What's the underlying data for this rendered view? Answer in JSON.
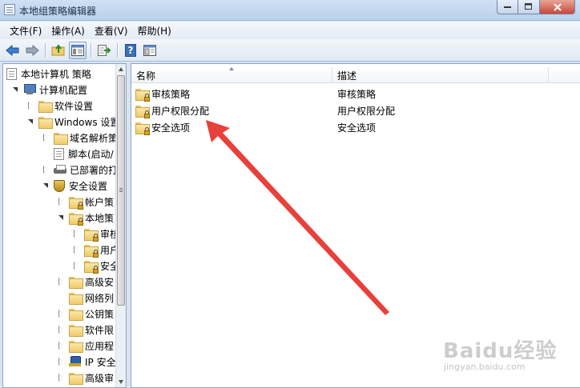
{
  "window": {
    "title": "本地组策略编辑器",
    "controls": [
      "minimize",
      "maximize",
      "close"
    ]
  },
  "menu": [
    "文件(F)",
    "操作(A)",
    "查看(V)",
    "帮助(H)"
  ],
  "toolbar": {
    "icons": [
      "back-icon",
      "forward-icon",
      "up-folder-icon",
      "show-hide-tree-icon",
      "export-list-icon",
      "help-icon",
      "properties-icon"
    ],
    "help_label": "?"
  },
  "tree": {
    "items": [
      {
        "label": "本地计算机 策略",
        "icon": "doc-icon"
      },
      {
        "label": "计算机配置",
        "icon": "computer-icon"
      },
      {
        "label": "软件设置",
        "icon": "folder-icon"
      },
      {
        "label": "Windows 设置",
        "icon": "folder-icon"
      },
      {
        "label": "域名解析策",
        "icon": "folder-icon"
      },
      {
        "label": "脚本(启动/",
        "icon": "script-icon"
      },
      {
        "label": "已部署的打",
        "icon": "printer-icon"
      },
      {
        "label": "安全设置",
        "icon": "shield-icon"
      },
      {
        "label": "帐户策",
        "icon": "lock-folder-icon"
      },
      {
        "label": "本地策",
        "icon": "lock-folder-icon"
      },
      {
        "label": "审核",
        "icon": "lock-folder-icon"
      },
      {
        "label": "用户",
        "icon": "lock-folder-icon"
      },
      {
        "label": "安全",
        "icon": "lock-folder-icon"
      },
      {
        "label": "高级安",
        "icon": "folder-icon"
      },
      {
        "label": "网络列",
        "icon": "folder-icon"
      },
      {
        "label": "公钥策",
        "icon": "folder-icon"
      },
      {
        "label": "软件限",
        "icon": "folder-icon"
      },
      {
        "label": "应用程",
        "icon": "folder-icon"
      },
      {
        "label": "IP 安全",
        "icon": "network-icon"
      },
      {
        "label": "高级审",
        "icon": "folder-icon"
      }
    ]
  },
  "list": {
    "columns": [
      "名称",
      "描述"
    ],
    "rows": [
      {
        "name": "审核策略",
        "desc": "审核策略"
      },
      {
        "name": "用户权限分配",
        "desc": "用户权限分配"
      },
      {
        "name": "安全选项",
        "desc": "安全选项"
      }
    ]
  },
  "annotation": {
    "color": "#e8403a"
  },
  "watermark": {
    "logo": "Baidu经验",
    "url": "jingyan.baidu.com"
  }
}
